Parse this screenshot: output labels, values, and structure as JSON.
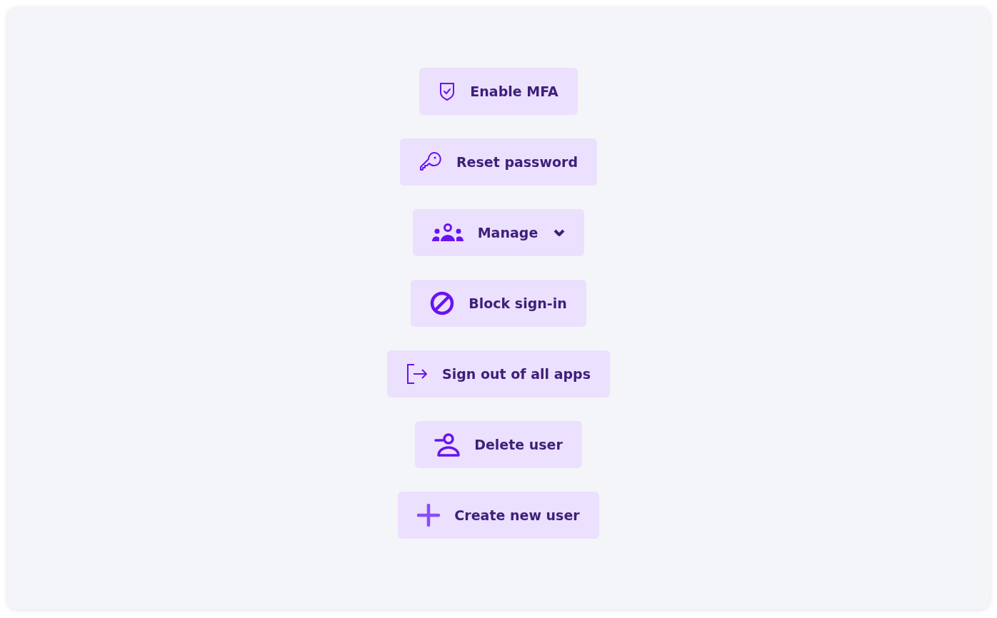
{
  "actions": [
    {
      "label": "Enable MFA",
      "kind": "shield",
      "dropdown": false
    },
    {
      "label": "Reset password",
      "kind": "key",
      "dropdown": false
    },
    {
      "label": "Manage",
      "kind": "group",
      "dropdown": true
    },
    {
      "label": "Block sign-in",
      "kind": "block",
      "dropdown": false
    },
    {
      "label": "Sign out of all apps",
      "kind": "signout",
      "dropdown": false
    },
    {
      "label": "Delete user",
      "kind": "remove-user",
      "dropdown": false
    },
    {
      "label": "Create new user",
      "kind": "plus",
      "dropdown": false
    }
  ]
}
